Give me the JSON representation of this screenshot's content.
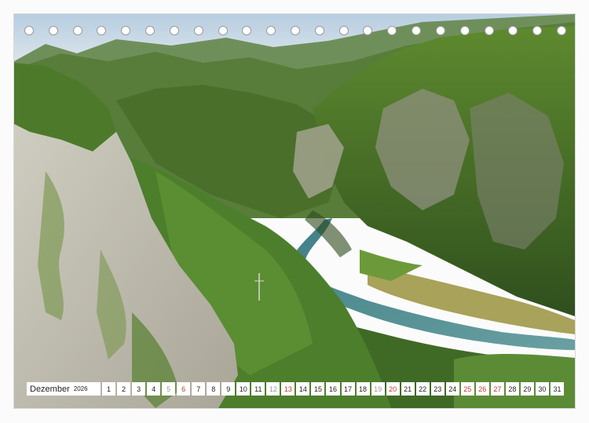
{
  "calendar": {
    "month": "Dezember",
    "year": "2026",
    "days": [
      {
        "n": "1",
        "c": "#222222"
      },
      {
        "n": "2",
        "c": "#222222"
      },
      {
        "n": "3",
        "c": "#222222"
      },
      {
        "n": "4",
        "c": "#222222"
      },
      {
        "n": "5",
        "c": "#9a9a9a"
      },
      {
        "n": "6",
        "c": "#c0392b"
      },
      {
        "n": "7",
        "c": "#222222"
      },
      {
        "n": "8",
        "c": "#222222"
      },
      {
        "n": "9",
        "c": "#222222"
      },
      {
        "n": "10",
        "c": "#222222"
      },
      {
        "n": "11",
        "c": "#222222"
      },
      {
        "n": "12",
        "c": "#9a9a9a"
      },
      {
        "n": "13",
        "c": "#c0392b"
      },
      {
        "n": "14",
        "c": "#222222"
      },
      {
        "n": "15",
        "c": "#222222"
      },
      {
        "n": "16",
        "c": "#222222"
      },
      {
        "n": "17",
        "c": "#222222"
      },
      {
        "n": "18",
        "c": "#222222"
      },
      {
        "n": "19",
        "c": "#9a9a9a"
      },
      {
        "n": "20",
        "c": "#c0392b"
      },
      {
        "n": "21",
        "c": "#222222"
      },
      {
        "n": "22",
        "c": "#222222"
      },
      {
        "n": "23",
        "c": "#222222"
      },
      {
        "n": "24",
        "c": "#222222"
      },
      {
        "n": "25",
        "c": "#c0392b"
      },
      {
        "n": "26",
        "c": "#c0392b"
      },
      {
        "n": "27",
        "c": "#c0392b"
      },
      {
        "n": "28",
        "c": "#222222"
      },
      {
        "n": "29",
        "c": "#222222"
      },
      {
        "n": "30",
        "c": "#222222"
      },
      {
        "n": "31",
        "c": "#222222"
      }
    ]
  },
  "binding": {
    "ring_count": 23,
    "ring_color": "#ffffff"
  },
  "photo": {
    "subject": "landscape-photo",
    "palette": {
      "sky": "#c9d8e6",
      "forest": "#4f7a2a",
      "rock": "#b9b7aa",
      "river": "#4e8a88",
      "meadow": "#a8a25a"
    }
  }
}
